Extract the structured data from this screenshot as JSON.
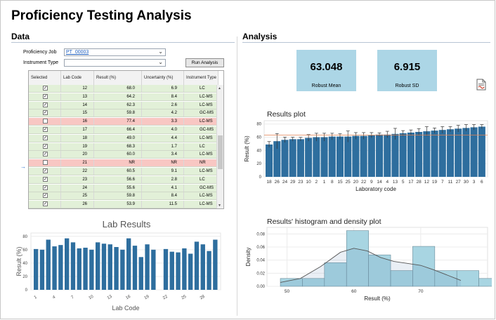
{
  "title": "Proficiency Testing Analysis",
  "data_section": {
    "heading": "Data",
    "job_label": "Proficiency Job",
    "job_value": "PT_00003",
    "instrument_label": "Instrument Type",
    "instrument_value": "",
    "run_button": "Run Analysis",
    "columns": [
      "Selected",
      "Lab Code",
      "Result (%)",
      "Uncertainty (%)",
      "Instrument Type"
    ],
    "rows": [
      {
        "checked": true,
        "lab": "12",
        "result": "68.0",
        "unc": "6.9",
        "inst": "LC",
        "flag": false
      },
      {
        "checked": true,
        "lab": "13",
        "result": "64.2",
        "unc": "8.4",
        "inst": "LC-MS",
        "flag": false
      },
      {
        "checked": true,
        "lab": "14",
        "result": "62.3",
        "unc": "2.6",
        "inst": "LC-MS",
        "flag": false
      },
      {
        "checked": true,
        "lab": "15",
        "result": "59.8",
        "unc": "4.2",
        "inst": "GC-MS",
        "flag": false
      },
      {
        "checked": false,
        "lab": "16",
        "result": "77.4",
        "unc": "3.3",
        "inst": "LC-MS",
        "flag": true
      },
      {
        "checked": true,
        "lab": "17",
        "result": "66.4",
        "unc": "4.0",
        "inst": "GC-MS",
        "flag": false
      },
      {
        "checked": true,
        "lab": "18",
        "result": "49.0",
        "unc": "4.4",
        "inst": "LC-MS",
        "flag": false
      },
      {
        "checked": true,
        "lab": "19",
        "result": "68.3",
        "unc": "1.7",
        "inst": "LC",
        "flag": false
      },
      {
        "checked": true,
        "lab": "20",
        "result": "60.0",
        "unc": "3.4",
        "inst": "LC-MS",
        "flag": false
      },
      {
        "checked": false,
        "lab": "21",
        "result": "NR",
        "unc": "NR",
        "inst": "NR",
        "flag": true
      },
      {
        "checked": true,
        "lab": "22",
        "result": "60.5",
        "unc": "9.1",
        "inst": "LC-MS",
        "flag": false
      },
      {
        "checked": true,
        "lab": "23",
        "result": "56.6",
        "unc": "2.8",
        "inst": "LC",
        "flag": false
      },
      {
        "checked": true,
        "lab": "24",
        "result": "55.6",
        "unc": "4.1",
        "inst": "GC-MS",
        "flag": false
      },
      {
        "checked": true,
        "lab": "25",
        "result": "59.8",
        "unc": "8.4",
        "inst": "LC-MS",
        "flag": false
      },
      {
        "checked": true,
        "lab": "26",
        "result": "53.9",
        "unc": "11.5",
        "inst": "LC-MS",
        "flag": false
      }
    ],
    "current_row_marker": "→",
    "scroll_up": "▲",
    "scroll_down": "▼"
  },
  "analysis_section": {
    "heading": "Analysis",
    "robust_mean_value": "63.048",
    "robust_mean_label": "Robust Mean",
    "robust_sd_value": "6.915",
    "robust_sd_label": "Robust SD",
    "export_icon": "pdf-export-icon"
  },
  "colors": {
    "bar": "#2e6e9e",
    "bar_light": "#a8d5e2",
    "row_ok": "#e2f0d8",
    "row_flag": "#f8c7c3",
    "stat_box": "#acd6e6",
    "robust_line": "#e08050"
  },
  "chart_data": [
    {
      "id": "lab-results",
      "type": "bar",
      "title": "Lab Results",
      "xlabel": "Lab Code",
      "ylabel": "Result (%)",
      "ylim": [
        0,
        85
      ],
      "yticks": [
        0,
        20,
        40,
        60,
        80
      ],
      "xticks": [
        "1",
        "4",
        "7",
        "10",
        "13",
        "16",
        "19",
        "22",
        "25",
        "28"
      ],
      "categories": [
        "1",
        "2",
        "3",
        "4",
        "5",
        "6",
        "7",
        "8",
        "9",
        "10",
        "11",
        "12",
        "13",
        "14",
        "15",
        "16",
        "17",
        "18",
        "19",
        "20",
        "21",
        "22",
        "23",
        "24",
        "25",
        "26",
        "27",
        "28",
        "29",
        "30"
      ],
      "values": [
        61,
        60,
        75,
        65,
        67,
        77,
        71,
        62,
        63,
        60,
        71,
        69,
        68,
        64,
        60,
        77,
        66,
        49,
        68,
        60,
        null,
        61,
        57,
        56,
        62,
        54,
        72,
        68,
        58,
        75
      ]
    },
    {
      "id": "results-plot",
      "type": "bar",
      "title": "Results plot",
      "xlabel": "Laboratory code",
      "ylabel": "Result (%)",
      "ylim": [
        0,
        85
      ],
      "yticks": [
        0,
        20,
        40,
        60,
        80
      ],
      "robust_mean": 63.048,
      "categories": [
        "18",
        "26",
        "24",
        "29",
        "23",
        "10",
        "2",
        "1",
        "8",
        "15",
        "25",
        "20",
        "22",
        "9",
        "14",
        "4",
        "13",
        "5",
        "17",
        "28",
        "12",
        "19",
        "7",
        "11",
        "27",
        "30",
        "3",
        "6"
      ],
      "values": [
        49,
        54,
        56,
        57,
        57,
        59,
        60,
        60,
        61,
        61,
        61,
        62,
        62,
        63,
        64,
        64,
        65,
        66,
        67,
        68,
        69,
        70,
        71,
        72,
        73,
        74,
        75,
        76
      ],
      "errors": [
        4.4,
        11.5,
        4.1,
        3,
        2.8,
        5,
        6,
        6,
        5,
        4.2,
        8.4,
        5,
        5,
        4,
        2.6,
        5,
        8.4,
        4,
        4.0,
        5,
        6.9,
        4,
        5,
        4,
        5,
        5,
        4,
        3
      ]
    },
    {
      "id": "histogram-density",
      "type": "histogram",
      "title": "Results' histogram and density plot",
      "xlabel": "Result (%)",
      "ylabel": "Density",
      "xticks": [
        50,
        60,
        70
      ],
      "xlim": [
        47,
        80
      ],
      "ylim": [
        0,
        0.09
      ],
      "yticks": [
        "0.00",
        "0.02",
        "0.04",
        "0.06",
        "0.08"
      ],
      "bin_edges": [
        49,
        52.3,
        55.6,
        58.9,
        62.2,
        65.5,
        68.8,
        72.1,
        75.4,
        78.7
      ],
      "densities": [
        0.012,
        0.012,
        0.036,
        0.085,
        0.048,
        0.024,
        0.061,
        0.024,
        0.024,
        0.012
      ],
      "density_curve": [
        [
          49,
          0.006
        ],
        [
          52,
          0.012
        ],
        [
          55,
          0.03
        ],
        [
          58,
          0.052
        ],
        [
          60,
          0.058
        ],
        [
          62,
          0.054
        ],
        [
          64,
          0.044
        ],
        [
          66,
          0.038
        ],
        [
          68,
          0.035
        ],
        [
          70,
          0.032
        ],
        [
          72,
          0.025
        ],
        [
          74,
          0.017
        ],
        [
          76,
          0.009
        ]
      ]
    }
  ]
}
